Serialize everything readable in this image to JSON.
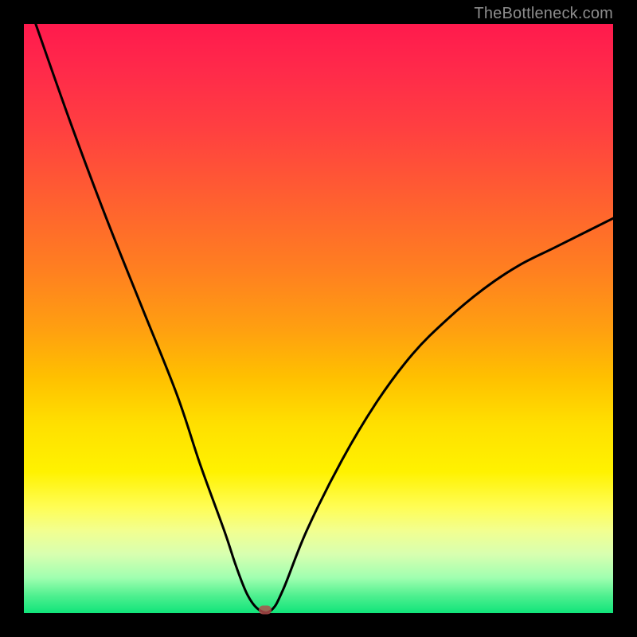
{
  "watermark": "TheBottleneck.com",
  "chart_data": {
    "type": "line",
    "title": "",
    "xlabel": "",
    "ylabel": "",
    "xlim": [
      0,
      100
    ],
    "ylim": [
      0,
      100
    ],
    "grid": false,
    "legend": false,
    "background": "rainbow-vertical-red-to-green",
    "series": [
      {
        "name": "bottleneck-curve",
        "x": [
          2,
          8,
          14,
          20,
          26,
          30,
          34,
          36,
          38,
          40,
          42,
          44,
          48,
          54,
          60,
          66,
          72,
          78,
          84,
          90,
          96,
          100
        ],
        "y": [
          100,
          83,
          67,
          52,
          37,
          25,
          14,
          8,
          3,
          0.5,
          0.5,
          4,
          14,
          26,
          36,
          44,
          50,
          55,
          59,
          62,
          65,
          67
        ]
      }
    ],
    "marker": {
      "x": 41,
      "y": 0.6,
      "shape": "rounded-rect",
      "color": "#b24a4a"
    },
    "annotations": []
  }
}
